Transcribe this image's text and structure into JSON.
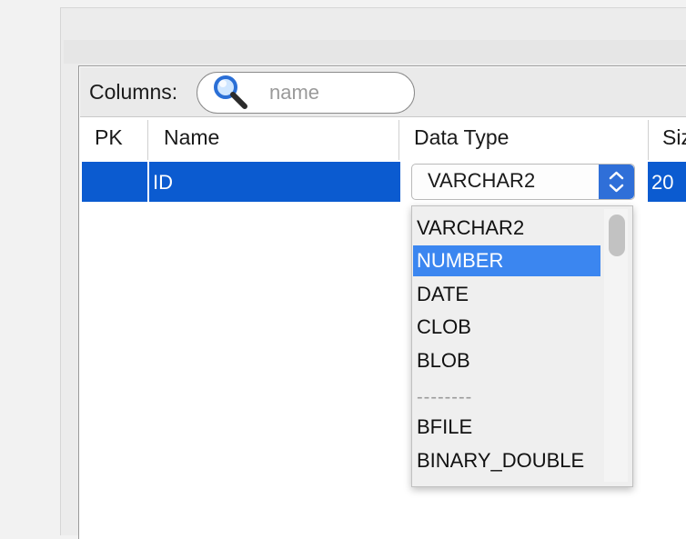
{
  "toolbar": {
    "columns_label": "Columns:",
    "search_placeholder": "name"
  },
  "table": {
    "headers": [
      "PK",
      "Name",
      "Data Type",
      "Siz"
    ],
    "selected_row": {
      "pk": "",
      "name": "ID",
      "data_type": "VARCHAR2",
      "size": "20"
    }
  },
  "dropdown": {
    "options": [
      "VARCHAR2",
      "NUMBER",
      "DATE",
      "CLOB",
      "BLOB",
      "--------",
      "BFILE",
      "BINARY_DOUBLE"
    ],
    "highlighted": "NUMBER"
  },
  "colors": {
    "selection": "#0b5bd0",
    "highlight": "#3b86f0",
    "combo_arrow": "#2f6fd8"
  },
  "icons": {
    "search": "magnifying-glass-icon",
    "combo": "up-down-chevron-icon"
  }
}
